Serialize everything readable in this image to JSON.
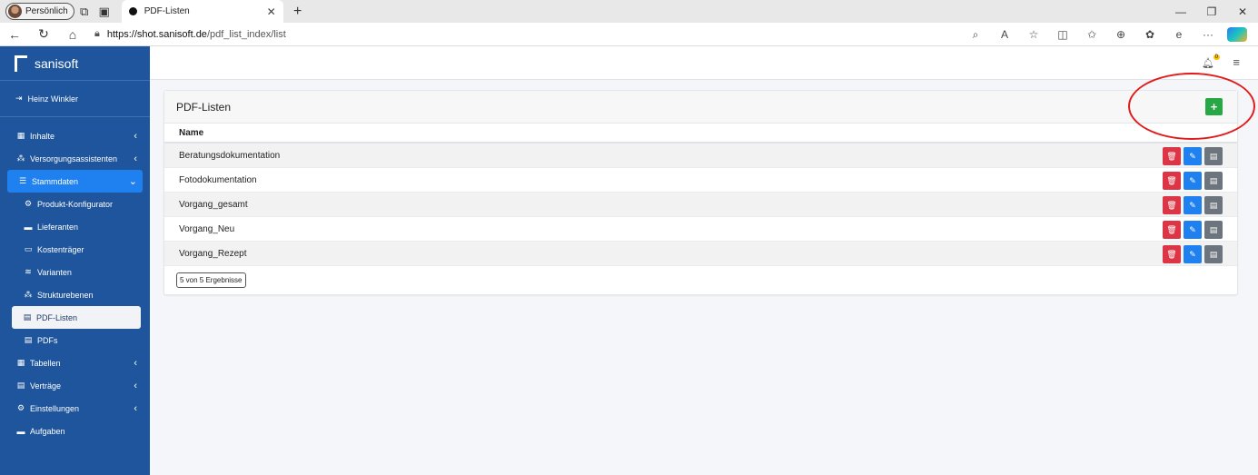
{
  "browser": {
    "profile_label": "Persönlich",
    "tab_title": "PDF-Listen",
    "url_host": "https://shot.sanisoft.de",
    "url_path": "/pdf_list_index/list"
  },
  "sidebar": {
    "brand": "sanisoft",
    "user": "Heinz Winkler",
    "items": [
      {
        "label": "Inhalte"
      },
      {
        "label": "Versorgungsassistenten"
      },
      {
        "label": "Stammdaten"
      },
      {
        "label": "Produkt-Konfigurator"
      },
      {
        "label": "Lieferanten"
      },
      {
        "label": "Kostenträger"
      },
      {
        "label": "Varianten"
      },
      {
        "label": "Strukturebenen"
      },
      {
        "label": "PDF-Listen"
      },
      {
        "label": "PDFs"
      },
      {
        "label": "Tabellen"
      },
      {
        "label": "Verträge"
      },
      {
        "label": "Einstellungen"
      },
      {
        "label": "Aufgaben"
      }
    ]
  },
  "topbar": {
    "notification_count": "0"
  },
  "card": {
    "title": "PDF-Listen",
    "column_name": "Name",
    "rows": [
      {
        "name": "Beratungsdokumentation"
      },
      {
        "name": "Fotodokumentation"
      },
      {
        "name": "Vorgang_gesamt"
      },
      {
        "name": "Vorgang_Neu"
      },
      {
        "name": "Vorgang_Rezept"
      }
    ],
    "results_text": "5 von 5 Ergebnisse"
  },
  "colors": {
    "sidebar": "#1e559c",
    "active": "#1f80f0",
    "add": "#28a745",
    "delete": "#dc3545",
    "pdf": "#6c757d",
    "annotation": "#e21b1b"
  }
}
